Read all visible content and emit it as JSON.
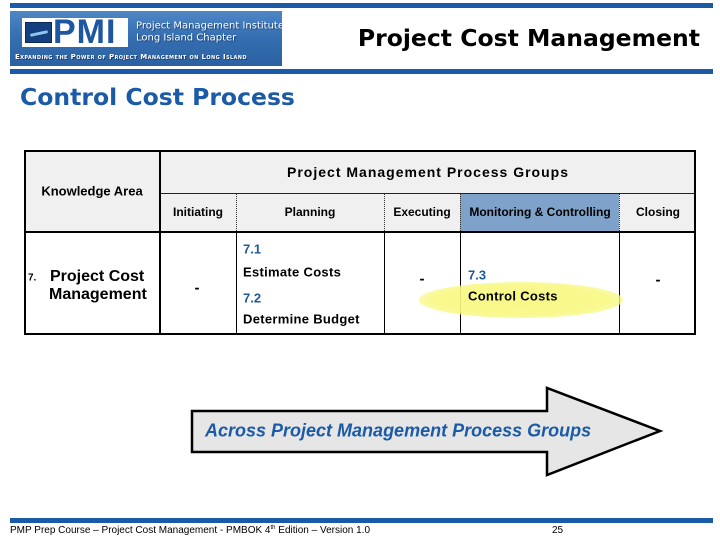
{
  "header": {
    "logo": {
      "mark": "PMI",
      "org_line1": "Project Management Institute",
      "org_line2": "Long Island Chapter",
      "tagline": "Expanding the Power of Project Management on Long Island"
    },
    "title": "Project Cost Management"
  },
  "slide": {
    "heading": "Control Cost Process"
  },
  "table": {
    "knowledge_area_header": "Knowledge Area",
    "process_groups_header": "Project Management Process Groups",
    "columns": [
      "Initiating",
      "Planning",
      "Executing",
      "Monitoring & Controlling",
      "Closing"
    ],
    "highlighted_column": "Monitoring & Controlling",
    "row": {
      "number": "7.",
      "knowledge_area_lines": [
        "Project Cost",
        "Management"
      ],
      "initiating": "-",
      "planning": [
        {
          "id": "7.1",
          "name": "Estimate Costs"
        },
        {
          "id": "7.2",
          "name": "Determine Budget"
        }
      ],
      "executing": "-",
      "monitoring_controlling": [
        {
          "id": "7.3",
          "name": "Control Costs",
          "highlighted": true
        }
      ],
      "closing": "-"
    }
  },
  "arrow": {
    "label": "Across Project Management Process Groups"
  },
  "footer": {
    "text_before_sup": "PMP Prep Course – Project Cost Management - PMBOK 4",
    "sup": "th",
    "text_after_sup": " Edition – Version 1.0",
    "page": "25"
  },
  "colors": {
    "brand_blue": "#1a5aa6",
    "process_id_blue": "#1f5a96",
    "header_bg": "#f0f0f0",
    "highlight_header": "#7ea2ca",
    "highlight_ellipse": "#f8f882",
    "arrow_fill": "#e6e6e6"
  }
}
